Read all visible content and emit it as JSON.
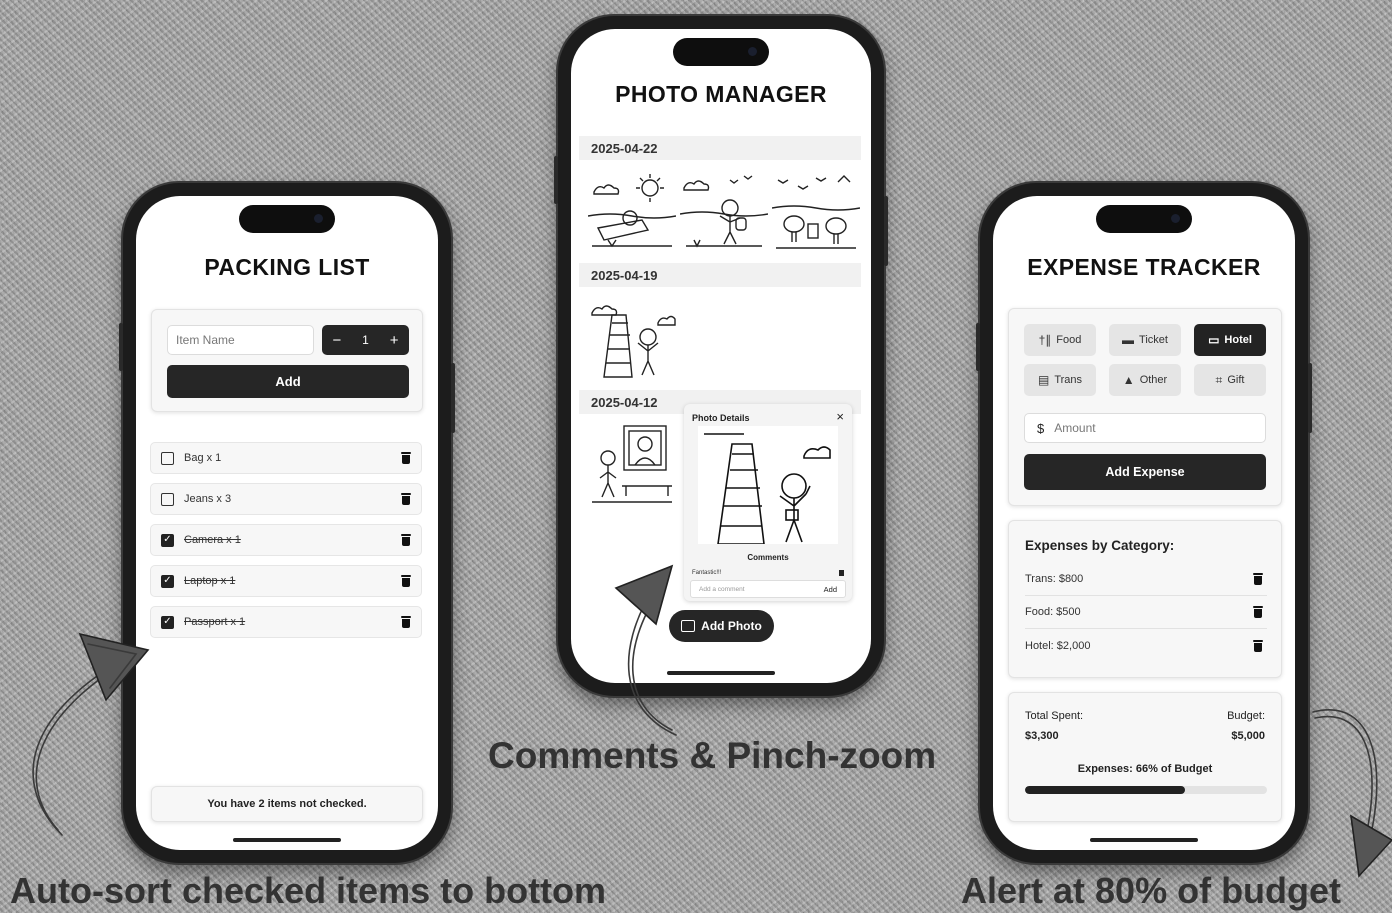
{
  "packing": {
    "title": "PACKING LIST",
    "item_placeholder": "Item Name",
    "qty_minus": "−",
    "qty_value": "1",
    "qty_plus": "+",
    "add_label": "Add",
    "items": [
      {
        "label": "Bag x 1",
        "checked": false
      },
      {
        "label": "Jeans x 3",
        "checked": false
      },
      {
        "label": "Camera x 1",
        "checked": true
      },
      {
        "label": "Laptop x 1",
        "checked": true
      },
      {
        "label": "Passport x 1",
        "checked": true
      }
    ],
    "status": "You have 2 items not checked."
  },
  "photos": {
    "title": "PHOTO MANAGER",
    "groups": [
      "2025-04-22",
      "2025-04-19",
      "2025-04-12"
    ],
    "details_title": "Photo Details",
    "close": "×",
    "comments_label": "Comments",
    "comment_text": "Fantastic!!!",
    "comment_placeholder": "Add a comment",
    "comment_add": "Add",
    "add_photo_label": "Add Photo"
  },
  "expense": {
    "title": "EXPENSE TRACKER",
    "categories": [
      {
        "label": "Food",
        "icon": "fork-knife-icon",
        "selected": false
      },
      {
        "label": "Ticket",
        "icon": "ticket-icon",
        "selected": false
      },
      {
        "label": "Hotel",
        "icon": "bed-icon",
        "selected": true
      },
      {
        "label": "Trans",
        "icon": "bus-icon",
        "selected": false
      },
      {
        "label": "Other",
        "icon": "shapes-icon",
        "selected": false
      },
      {
        "label": "Gift",
        "icon": "cart-icon",
        "selected": false
      }
    ],
    "currency": "$",
    "amount_placeholder": "Amount",
    "add_label": "Add Expense",
    "by_category_title": "Expenses by Category:",
    "entries": [
      "Trans: $800",
      "Food: $500",
      "Hotel: $2,000"
    ],
    "total_label": "Total Spent:",
    "total_value": "$3,300",
    "budget_label": "Budget:",
    "budget_value": "$5,000",
    "progress_text": "Expenses: 66% of Budget",
    "progress_fraction": 0.66
  },
  "captions": {
    "left": "Auto-sort checked items to bottom",
    "middle": "Comments & Pinch-zoom",
    "right": "Alert at 80% of budget"
  },
  "colors": {
    "dark": "#262626",
    "progress_fill": "#222222",
    "progress_track": "#e3e3e3"
  }
}
